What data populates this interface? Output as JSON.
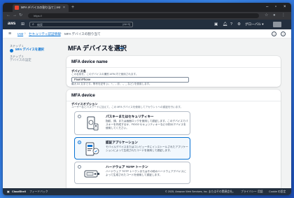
{
  "browser": {
    "tab_title": "MFA デバイスの割り当て | IAM | Gl...",
    "tab_close": "×",
    "new_tab": "+",
    "address": "https://"
  },
  "aws": {
    "logo": "aws",
    "search_placeholder": "検索",
    "search_shortcut": "[Alt+S]",
    "region": "グローバル ▾"
  },
  "breadcrumb": {
    "items": [
      "IAM",
      "セキュリティ認証情報",
      "MFA デバイスの割り当て"
    ],
    "separator": "›"
  },
  "steps": [
    {
      "num": "ステップ 1",
      "label": "MFA デバイスを選択",
      "active": true
    },
    {
      "num": "ステップ 2",
      "label": "デバイスの設定",
      "active": false
    }
  ],
  "page": {
    "title": "MFA デバイスを選択",
    "info": "Info"
  },
  "device_name_card": {
    "title": "MFA device name",
    "field_label": "デバイス名",
    "field_desc": "この名前を、このデバイスの識別 ARN 内で使用されます。",
    "value": "Pixel iPhone",
    "hint": "最大 64 文字です。等号を記号 (=、+、., ＠、-、_ など) を使用します。"
  },
  "device_card": {
    "title": "MFA device",
    "options_label": "デバイスオプション",
    "options_desc": "ユーザー名とパスワードに加えて、この MFA デバイスを使用してアカウントへの認証を行います。",
    "options": [
      {
        "title": "パスキーまたはセキュリティキー",
        "desc": "指紋、顔、または画面ロックを使用して認証します。このデバイスでパスキーを作成するか、FIDO2 セキュリティキーなどの別のデバイスを使用してください。",
        "selected": false
      },
      {
        "title": "認証アプリケーション",
        "desc": "モバイルデバイスまたはコンピュータにインストールされたアプリケーションによって生成されたコードを使用して認証します。",
        "selected": true
      },
      {
        "title": "ハードウェア TOTP トークン",
        "desc": "ハードウェア TOTP トークンまたはその他のハードウェアデバイスによって生成されたコードを使用して認証します。",
        "selected": false
      }
    ]
  },
  "footer": {
    "cloudshell": "CloudShell",
    "feedback": "フィードバック",
    "copyright": "© 2025, Amazon Web Services, Inc. またはその関連会社。",
    "privacy": "プライバシー",
    "terms": "用語",
    "cookie": "Cookie の設定"
  },
  "colors": {
    "accent": "#0972d3",
    "aws_nav": "#232f3e",
    "selected_tile_bg": "#f2f8fd"
  }
}
